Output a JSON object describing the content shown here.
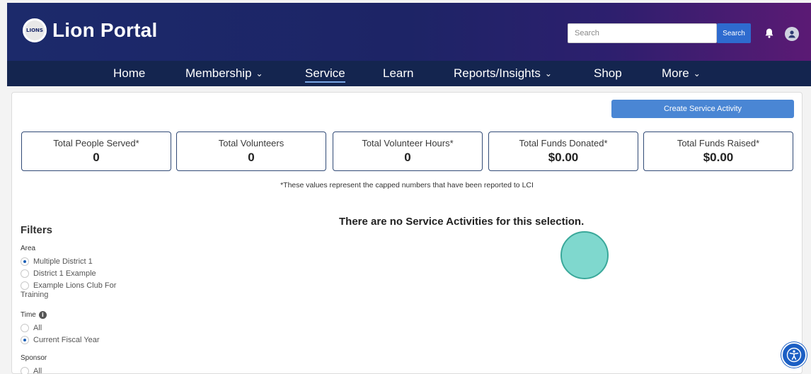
{
  "header": {
    "logo_mark": "LIONS",
    "app_title": "Lion Portal",
    "search_placeholder": "Search",
    "search_button": "Search"
  },
  "nav": {
    "items": [
      {
        "label": "Home",
        "has_menu": false
      },
      {
        "label": "Membership",
        "has_menu": true
      },
      {
        "label": "Service",
        "has_menu": false,
        "active": true
      },
      {
        "label": "Learn",
        "has_menu": false
      },
      {
        "label": "Reports/Insights",
        "has_menu": true
      },
      {
        "label": "Shop",
        "has_menu": false
      },
      {
        "label": "More",
        "has_menu": true
      }
    ]
  },
  "actions": {
    "create_label": "Create Service Activity"
  },
  "stats": [
    {
      "label": "Total People Served*",
      "value": "0"
    },
    {
      "label": "Total Volunteers",
      "value": "0"
    },
    {
      "label": "Total Volunteer Hours*",
      "value": "0"
    },
    {
      "label": "Total Funds Donated*",
      "value": "$0.00"
    },
    {
      "label": "Total Funds Raised*",
      "value": "$0.00"
    }
  ],
  "note": "*These values represent the capped numbers that have been reported to LCI",
  "empty_message": "There are no Service Activities for this selection.",
  "filters": {
    "title": "Filters",
    "area": {
      "label": "Area",
      "options": [
        {
          "label": "Multiple District 1",
          "checked": true
        },
        {
          "label": "District 1 Example",
          "checked": false
        },
        {
          "label": "Example Lions Club For",
          "cont": "Training",
          "checked": false
        }
      ]
    },
    "time": {
      "label": "Time",
      "info": "i",
      "options": [
        {
          "label": "All",
          "checked": false
        },
        {
          "label": "Current Fiscal Year",
          "checked": true
        }
      ]
    },
    "sponsor": {
      "label": "Sponsor",
      "options": [
        {
          "label": "All",
          "checked": false
        }
      ]
    }
  },
  "colors": {
    "header_start": "#1c2a6b",
    "header_end": "#5b1a74",
    "nav_bg": "#14254f",
    "accent": "#4a86d4",
    "stat_border": "#314a76"
  },
  "icons": [
    "lions-logo-icon",
    "bell-icon",
    "user-avatar-icon",
    "chevron-down-icon",
    "info-icon",
    "accessibility-icon"
  ]
}
